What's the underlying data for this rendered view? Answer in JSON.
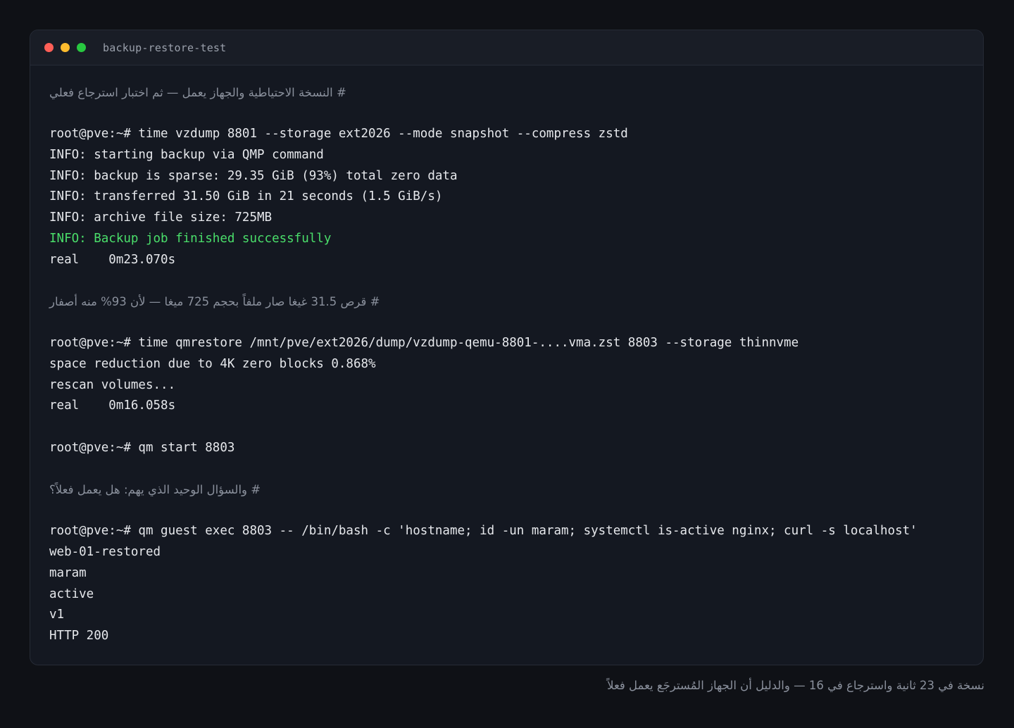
{
  "window": {
    "title": "backup-restore-test"
  },
  "terminal": {
    "lines": [
      {
        "kind": "comment",
        "text": "# النسخة الاحتياطية والجهاز يعمل — ثم اختبار استرجاع فعلي"
      },
      {
        "kind": "blank",
        "text": ""
      },
      {
        "kind": "command",
        "text": "root@pve:~# time vzdump 8801 --storage ext2026 --mode snapshot --compress zstd"
      },
      {
        "kind": "output",
        "text": "INFO: starting backup via QMP command"
      },
      {
        "kind": "output",
        "text": "INFO: backup is sparse: 29.35 GiB (93%) total zero data"
      },
      {
        "kind": "output",
        "text": "INFO: transferred 31.50 GiB in 21 seconds (1.5 GiB/s)"
      },
      {
        "kind": "output",
        "text": "INFO: archive file size: 725MB"
      },
      {
        "kind": "success",
        "text": "INFO: Backup job finished successfully"
      },
      {
        "kind": "output",
        "text": "real    0m23.070s"
      },
      {
        "kind": "blank",
        "text": ""
      },
      {
        "kind": "comment",
        "text": "# قرص 31.5 غيغا صار ملفاً بحجم 725 ميغا — لأن 93% منه أصفار"
      },
      {
        "kind": "blank",
        "text": ""
      },
      {
        "kind": "command",
        "text": "root@pve:~# time qmrestore /mnt/pve/ext2026/dump/vzdump-qemu-8801-....vma.zst 8803 --storage thinnvme"
      },
      {
        "kind": "output",
        "text": "space reduction due to 4K zero blocks 0.868%"
      },
      {
        "kind": "output",
        "text": "rescan volumes..."
      },
      {
        "kind": "output",
        "text": "real    0m16.058s"
      },
      {
        "kind": "blank",
        "text": ""
      },
      {
        "kind": "command",
        "text": "root@pve:~# qm start 8803"
      },
      {
        "kind": "blank",
        "text": ""
      },
      {
        "kind": "comment",
        "text": "# والسؤال الوحيد الذي يهم: هل يعمل فعلاً؟"
      },
      {
        "kind": "blank",
        "text": ""
      },
      {
        "kind": "command",
        "text": "root@pve:~# qm guest exec 8803 -- /bin/bash -c 'hostname; id -un maram; systemctl is-active nginx; curl -s localhost'"
      },
      {
        "kind": "output",
        "text": "web-01-restored"
      },
      {
        "kind": "output",
        "text": "maram"
      },
      {
        "kind": "output",
        "text": "active"
      },
      {
        "kind": "output",
        "text": "v1"
      },
      {
        "kind": "output",
        "text": "HTTP 200"
      }
    ]
  },
  "caption": "نسخة في 23 ثانية واسترجاع في 16 — والدليل أن الجهاز المُسترجَع يعمل فعلاً"
}
